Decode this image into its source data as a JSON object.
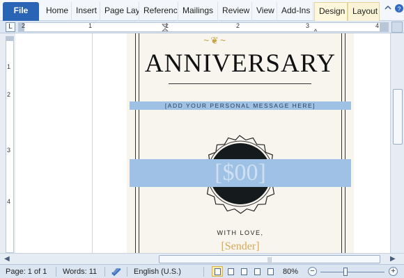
{
  "ribbon": {
    "tabs": [
      {
        "label": "File"
      },
      {
        "label": "Home"
      },
      {
        "label": "Insert"
      },
      {
        "label": "Page Lay"
      },
      {
        "label": "Referenc"
      },
      {
        "label": "Mailings"
      },
      {
        "label": "Review"
      },
      {
        "label": "View"
      },
      {
        "label": "Add-Ins"
      },
      {
        "label": "Design"
      },
      {
        "label": "Layout"
      }
    ],
    "minimize_icon": "chevron-up-icon",
    "help_icon": "help-icon"
  },
  "ruler": {
    "tab_selector_glyph": "L",
    "h_numbers": [
      "2",
      "1",
      "1",
      "2",
      "3",
      "4"
    ],
    "v_numbers": [
      "1",
      "2",
      "3",
      "4"
    ]
  },
  "document": {
    "title": "ANNIVERSARY",
    "message": "[ADD YOUR PERSONAL MESSAGE HERE]",
    "amount": "[$00]",
    "closing": "WITH LOVE,",
    "sender": "[Sender]",
    "flourish": "~❦~"
  },
  "status_bar": {
    "page": "Page: 1 of 1",
    "words": "Words: 11",
    "language": "English (U.S.)",
    "zoom": "80%",
    "zoom_minus": "−",
    "zoom_plus": "+",
    "zoom_level_percent": 80
  },
  "colors": {
    "file_tab": "#2a64b5",
    "highlight": "#9fc1e6",
    "seal_fill": "#151a1c",
    "sender": "#d9a857",
    "flourish": "#c9a44a"
  }
}
